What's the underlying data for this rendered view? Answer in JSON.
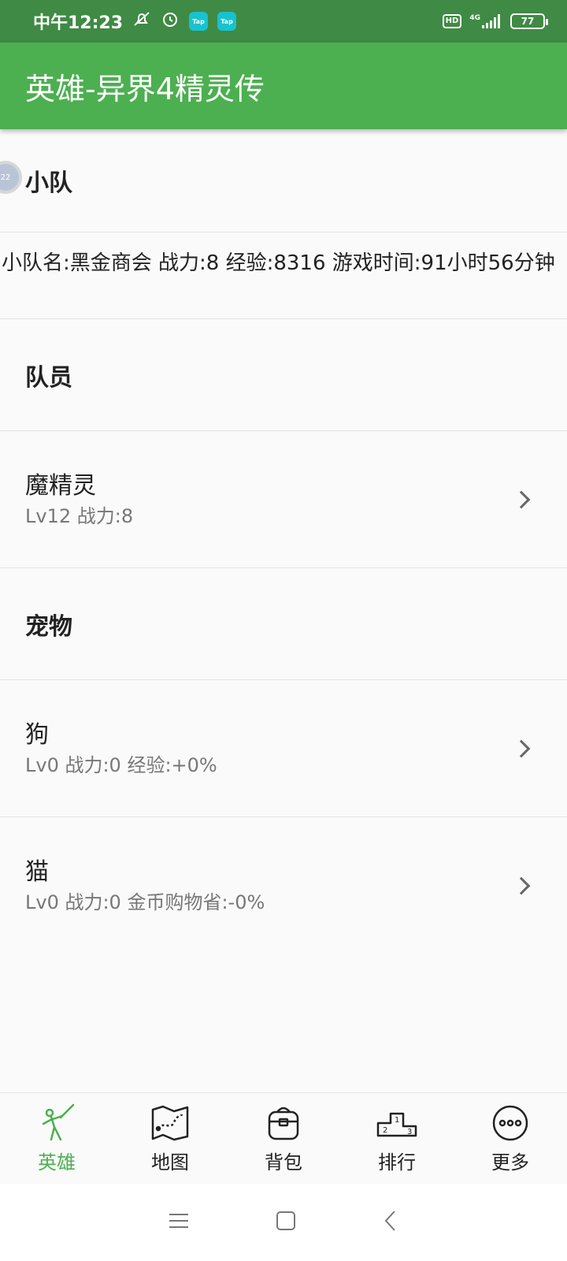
{
  "status_bar": {
    "time": "中午12:23",
    "tap_badge_1": "Tap",
    "tap_badge_2": "Tap",
    "hd": "HD",
    "network": "4G",
    "battery": "77"
  },
  "app_bar": {
    "title": "英雄-异界4精灵传"
  },
  "team": {
    "title": "小队",
    "avatar_text": "22",
    "info": "小队名:黑金商会  战力:8  经验:8316  游戏时间:91小时56分钟"
  },
  "members": {
    "title": "队员",
    "items": [
      {
        "name": "魔精灵",
        "detail": "Lv12 战力:8"
      }
    ]
  },
  "pets": {
    "title": "宠物",
    "items": [
      {
        "name": "狗",
        "detail": "Lv0 战力:0 经验:+0%"
      },
      {
        "name": "猫",
        "detail": "Lv0 战力:0 金币购物省:-0%"
      }
    ]
  },
  "bottom_nav": {
    "items": [
      {
        "label": "英雄",
        "icon": "hero-icon",
        "active": true
      },
      {
        "label": "地图",
        "icon": "map-icon",
        "active": false
      },
      {
        "label": "背包",
        "icon": "backpack-icon",
        "active": false
      },
      {
        "label": "排行",
        "icon": "podium-icon",
        "active": false
      },
      {
        "label": "更多",
        "icon": "more-icon",
        "active": false
      }
    ]
  },
  "colors": {
    "status_bar": "#3f8a44",
    "app_bar": "#4caf50",
    "accent": "#4caf50"
  }
}
